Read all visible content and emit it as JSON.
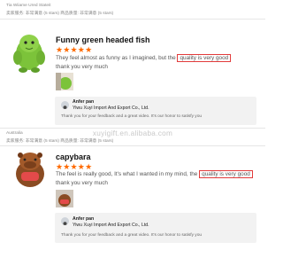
{
  "watermark": "xuyigift.en.alibaba.com",
  "reviews": [
    {
      "buyer": "Tia Wiiame Ured Stateit",
      "ratings": "卖家服务: 非常满意 (5 stars)     商品质量: 非常满意 (5 stars)",
      "title": "Funny green headed fish",
      "stars": "★★★★★",
      "text_before": "They feel almost as funny as I imagined, but the ",
      "text_highlight": "quality is very good",
      "text_line2": "thank you very much",
      "reply": {
        "seller_name": "Anfer pan",
        "company": "Yiwu Xuyi Import And Export Co., Ltd.",
        "message": "Thank you for your feedback and a great video. It's our honor to satisfy you"
      }
    },
    {
      "buyer": "Australia",
      "ratings": "卖家服务: 非常满意 (5 stars)     商品质量: 非常满意 (5 stars)",
      "title": "capybara",
      "stars": "★★★★★",
      "text_before": "The feel is really good, It's what I wanted in my mind, the ",
      "text_highlight": "quality is very good",
      "text_line2": "thank you very much",
      "reply": {
        "seller_name": "Anfer pan",
        "company": "Yiwu Xuyi Import And Export Co., Ltd.",
        "message": "Thank you for your feedback and a great video. It's our honor to satisfy you"
      }
    }
  ],
  "colors": {
    "accent": "#ff6a00",
    "highlight_border": "#e23b3b",
    "reply_bg": "#f2f2f2"
  },
  "icons": [
    "green-fish-plush-image",
    "capybara-plush-image",
    "review-photo-thumbnail",
    "seller-avatar"
  ]
}
